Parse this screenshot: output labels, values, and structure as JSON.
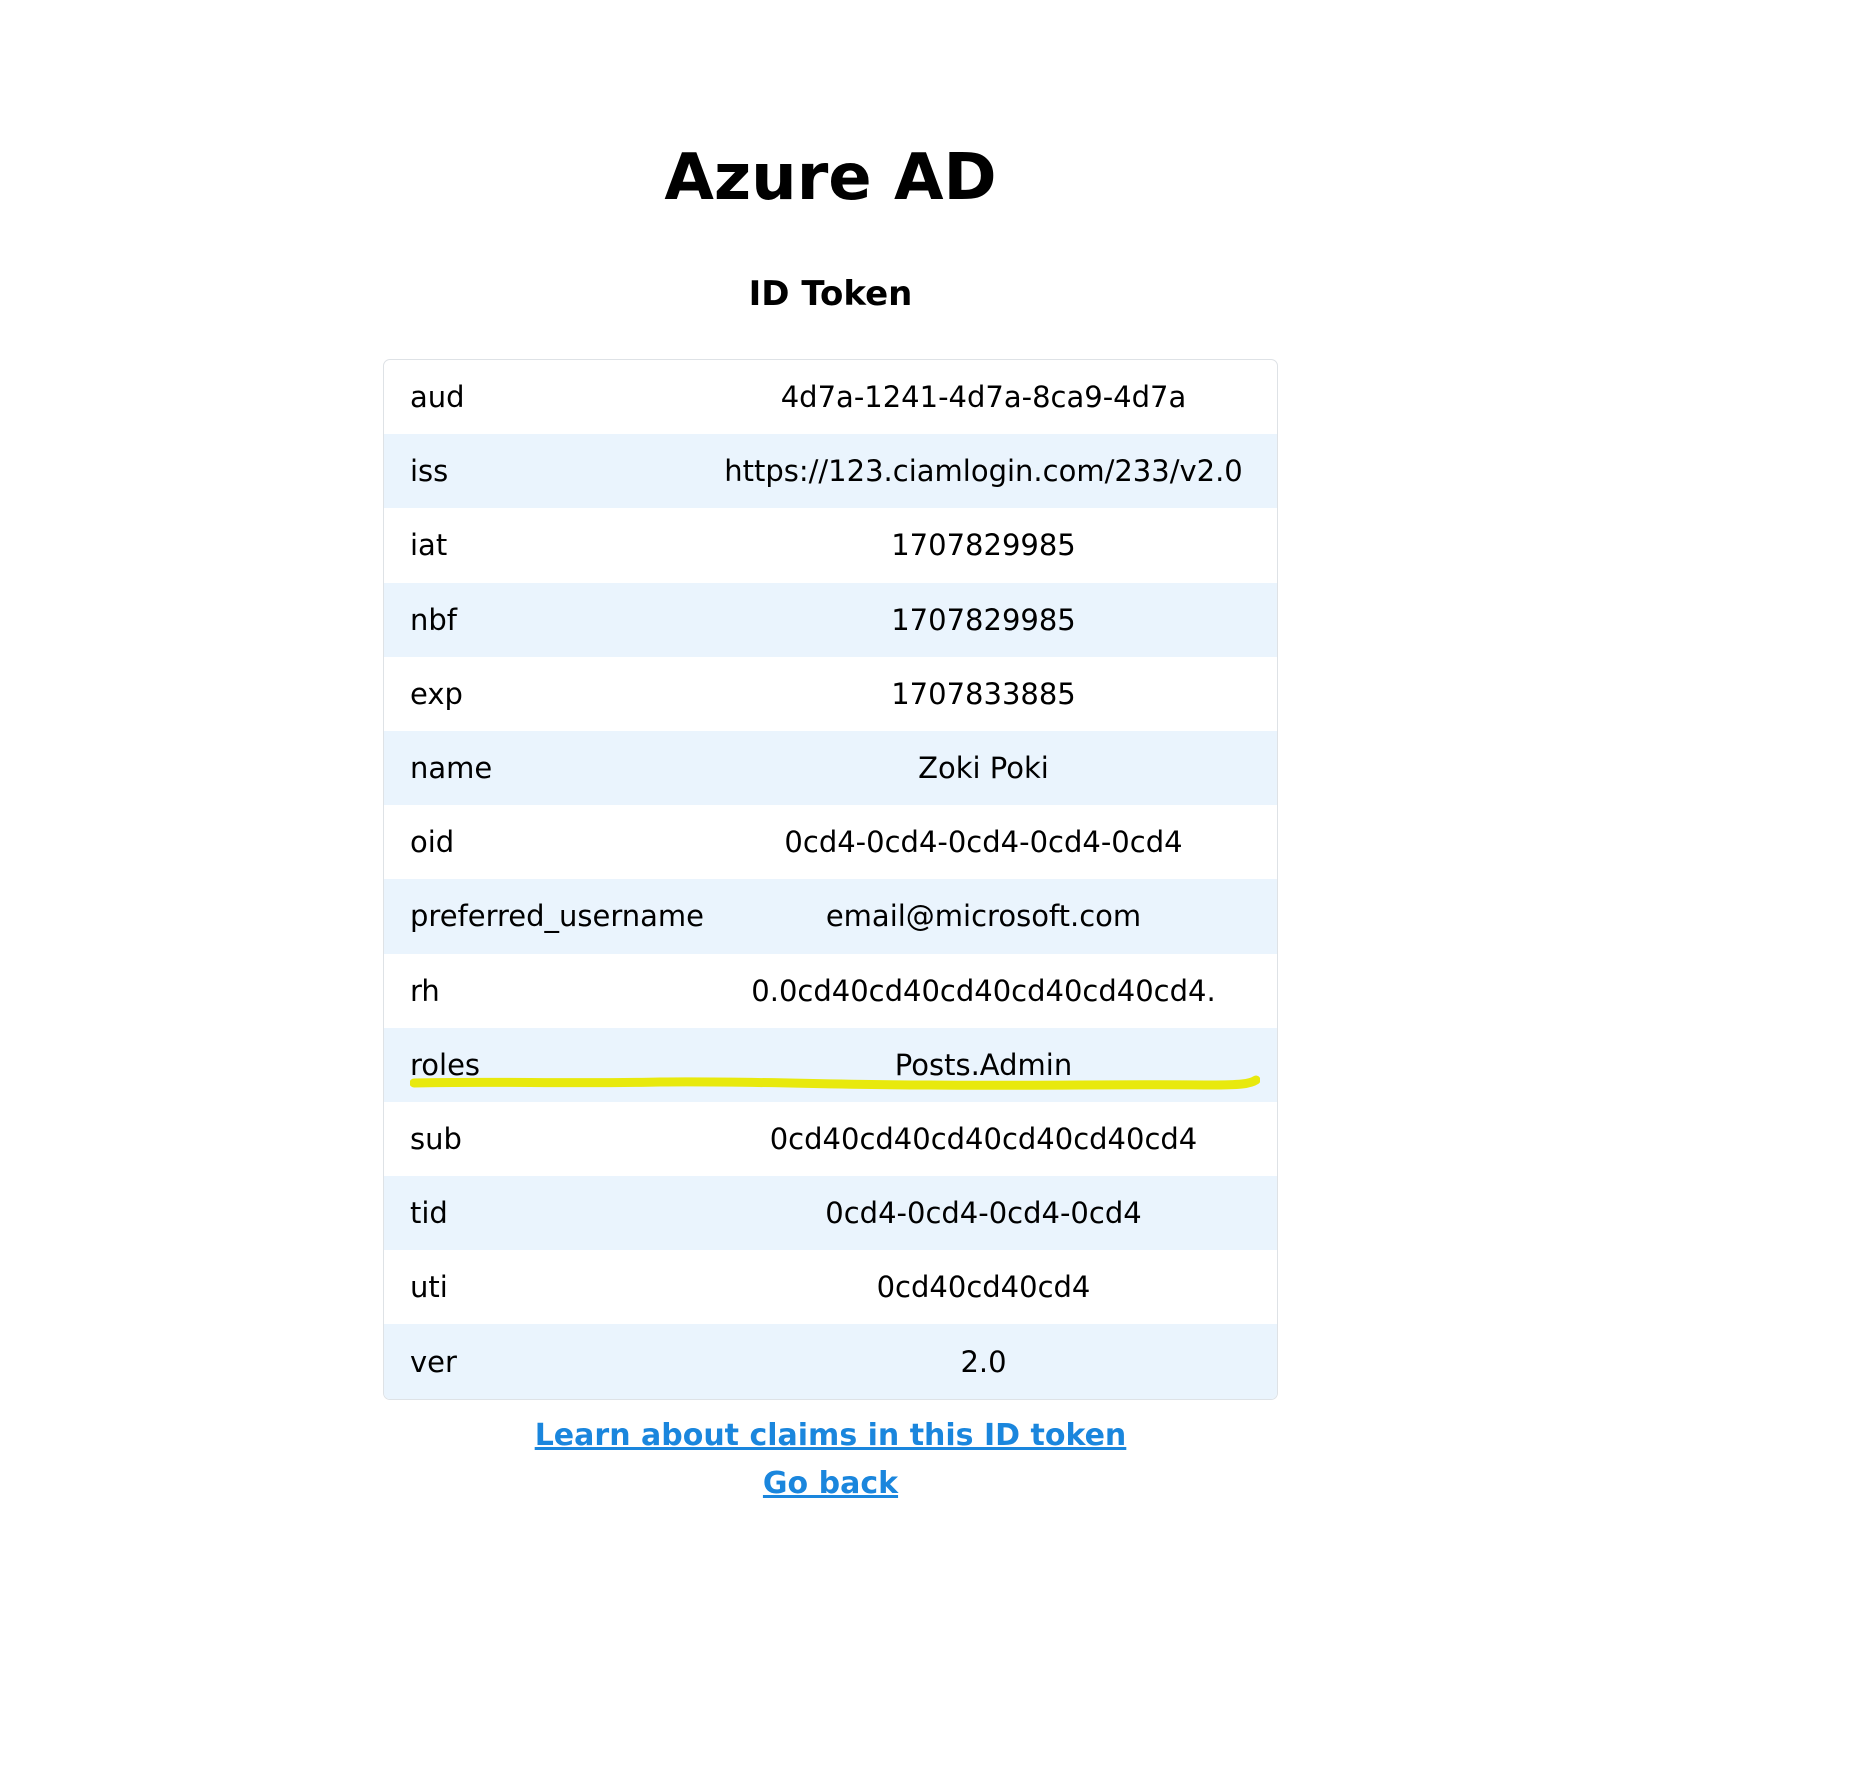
{
  "header": {
    "title": "Azure AD"
  },
  "section": {
    "title": "ID Token"
  },
  "claims": [
    {
      "key": "aud",
      "value": "4d7a-1241-4d7a-8ca9-4d7a"
    },
    {
      "key": "iss",
      "value": "https://123.ciamlogin.com/233/v2.0"
    },
    {
      "key": "iat",
      "value": "1707829985"
    },
    {
      "key": "nbf",
      "value": "1707829985"
    },
    {
      "key": "exp",
      "value": "1707833885"
    },
    {
      "key": "name",
      "value": "Zoki Poki"
    },
    {
      "key": "oid",
      "value": "0cd4-0cd4-0cd4-0cd4-0cd4"
    },
    {
      "key": "preferred_username",
      "value": "email@microsoft.com"
    },
    {
      "key": "rh",
      "value": "0.0cd40cd40cd40cd40cd40cd4."
    },
    {
      "key": "roles",
      "value": "Posts.Admin"
    },
    {
      "key": "sub",
      "value": "0cd40cd40cd40cd40cd40cd4"
    },
    {
      "key": "tid",
      "value": "0cd4-0cd4-0cd4-0cd4"
    },
    {
      "key": "uti",
      "value": "0cd40cd40cd4"
    },
    {
      "key": "ver",
      "value": "2.0"
    }
  ],
  "links": {
    "learn_label": "Learn about claims in this ID token",
    "back_label": "Go back"
  },
  "colors": {
    "link": "#1a86dd",
    "row_stripe": "#eaf4fd",
    "highlight": "#e8e800"
  }
}
